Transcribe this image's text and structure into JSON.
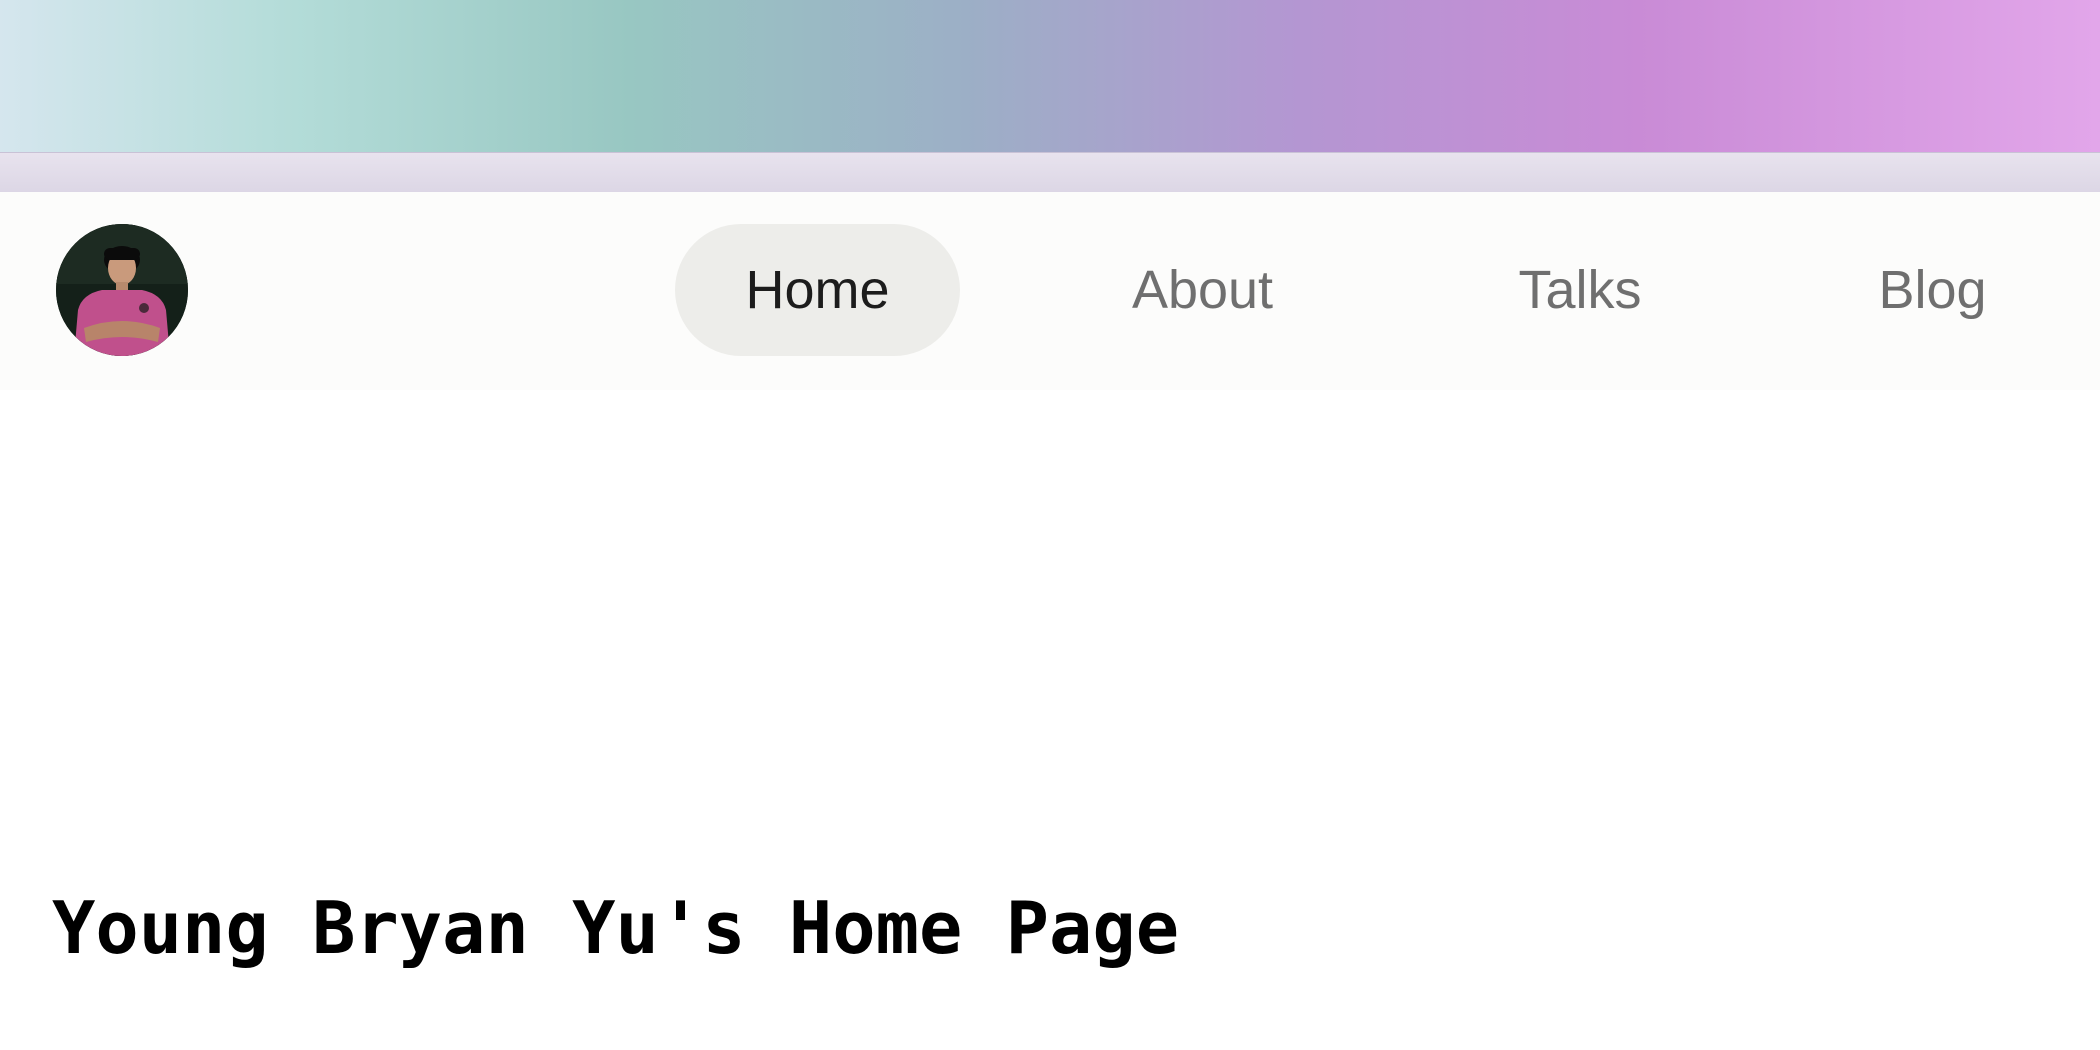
{
  "header": {
    "nav": [
      {
        "label": "Home",
        "active": true
      },
      {
        "label": "About",
        "active": false
      },
      {
        "label": "Talks",
        "active": false
      },
      {
        "label": "Blog",
        "active": false
      }
    ]
  },
  "main": {
    "title": "Young Bryan Yu's Home Page"
  },
  "colors": {
    "active_pill": "#ededea",
    "nav_text": "#6f6f6f",
    "active_text": "#1c1c1c",
    "gradient_start": "#d5e6ee",
    "gradient_end": "#e2a6ea"
  }
}
